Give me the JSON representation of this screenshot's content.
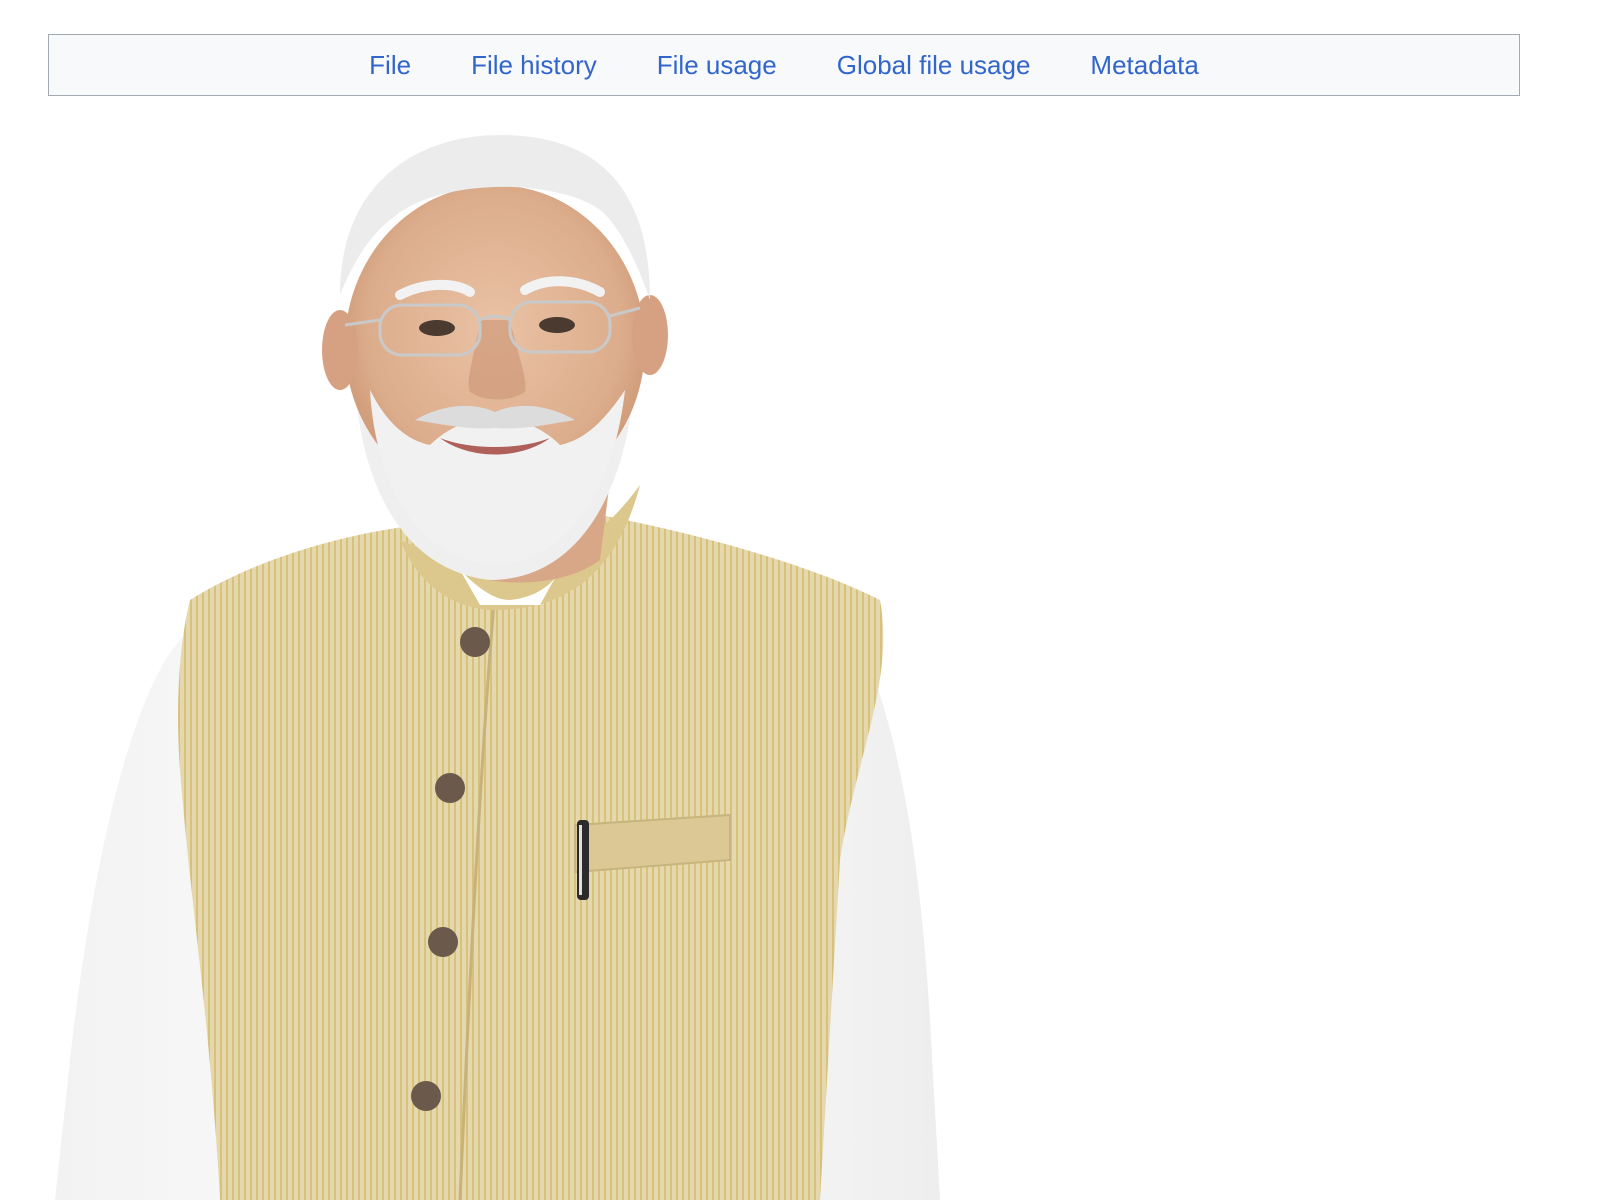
{
  "file_toc": {
    "items": [
      {
        "label": "File"
      },
      {
        "label": "File history"
      },
      {
        "label": "File usage"
      },
      {
        "label": "Global file usage"
      },
      {
        "label": "Metadata"
      }
    ]
  },
  "file_image": {
    "subject": "portrait-photo",
    "colors": {
      "background": "#ffffff",
      "hair": "#e9e9e9",
      "skin": "#e2b597",
      "skin_shadow": "#c98f6e",
      "beard": "#eeeeee",
      "vest": "#e3d3a4",
      "vest_stripe": "#d9c37c",
      "kurta": "#fbfbfb",
      "button": "#6b5a4c",
      "link": "#3366cc",
      "toc_border": "#a2a9b1",
      "toc_background": "#f8f9fa"
    }
  }
}
